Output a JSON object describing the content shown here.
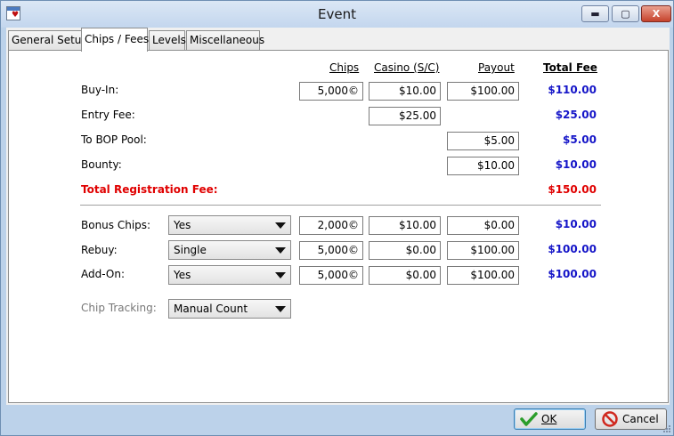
{
  "window": {
    "title": "Event"
  },
  "titlebar_buttons": {
    "minimize": "▬",
    "maximize": "▢",
    "close": "X"
  },
  "tabs": [
    {
      "label": "General Setup",
      "active": false
    },
    {
      "label": "Chips / Fees",
      "active": true
    },
    {
      "label": "Levels",
      "active": false
    },
    {
      "label": "Miscellaneous",
      "active": false
    }
  ],
  "headers": {
    "chips": "Chips",
    "casino": "Casino (S/C)",
    "payout": "Payout",
    "total_fee": "Total Fee"
  },
  "fees": {
    "buy_in": {
      "label": "Buy-In:",
      "chips": "5,000©",
      "casino": "$10.00",
      "payout": "$100.00",
      "total": "$110.00"
    },
    "entry_fee": {
      "label": "Entry Fee:",
      "casino": "$25.00",
      "total": "$25.00"
    },
    "bop_pool": {
      "label": "To BOP Pool:",
      "payout": "$5.00",
      "total": "$5.00"
    },
    "bounty": {
      "label": "Bounty:",
      "payout": "$10.00",
      "total": "$10.00"
    },
    "total_registration": {
      "label": "Total Registration Fee:",
      "total": "$150.00"
    }
  },
  "extras": {
    "bonus_chips": {
      "label": "Bonus Chips:",
      "select": "Yes",
      "chips": "2,000©",
      "casino": "$10.00",
      "payout": "$0.00",
      "total": "$10.00"
    },
    "rebuy": {
      "label": "Rebuy:",
      "select": "Single",
      "chips": "5,000©",
      "casino": "$0.00",
      "payout": "$100.00",
      "total": "$100.00"
    },
    "add_on": {
      "label": "Add-On:",
      "select": "Yes",
      "chips": "5,000©",
      "casino": "$0.00",
      "payout": "$100.00",
      "total": "$100.00"
    },
    "chip_tracking": {
      "label": "Chip Tracking:",
      "select": "Manual Count"
    }
  },
  "buttons": {
    "ok": "OK",
    "cancel": "Cancel"
  },
  "colors": {
    "total_blue": "#1515c8",
    "total_red": "#e00000",
    "ok_check": "#2a9d2a",
    "cancel_red": "#d0281e"
  },
  "icons": {
    "ok": "checkmark-icon",
    "cancel": "no-entry-icon",
    "app": "app-icon"
  }
}
